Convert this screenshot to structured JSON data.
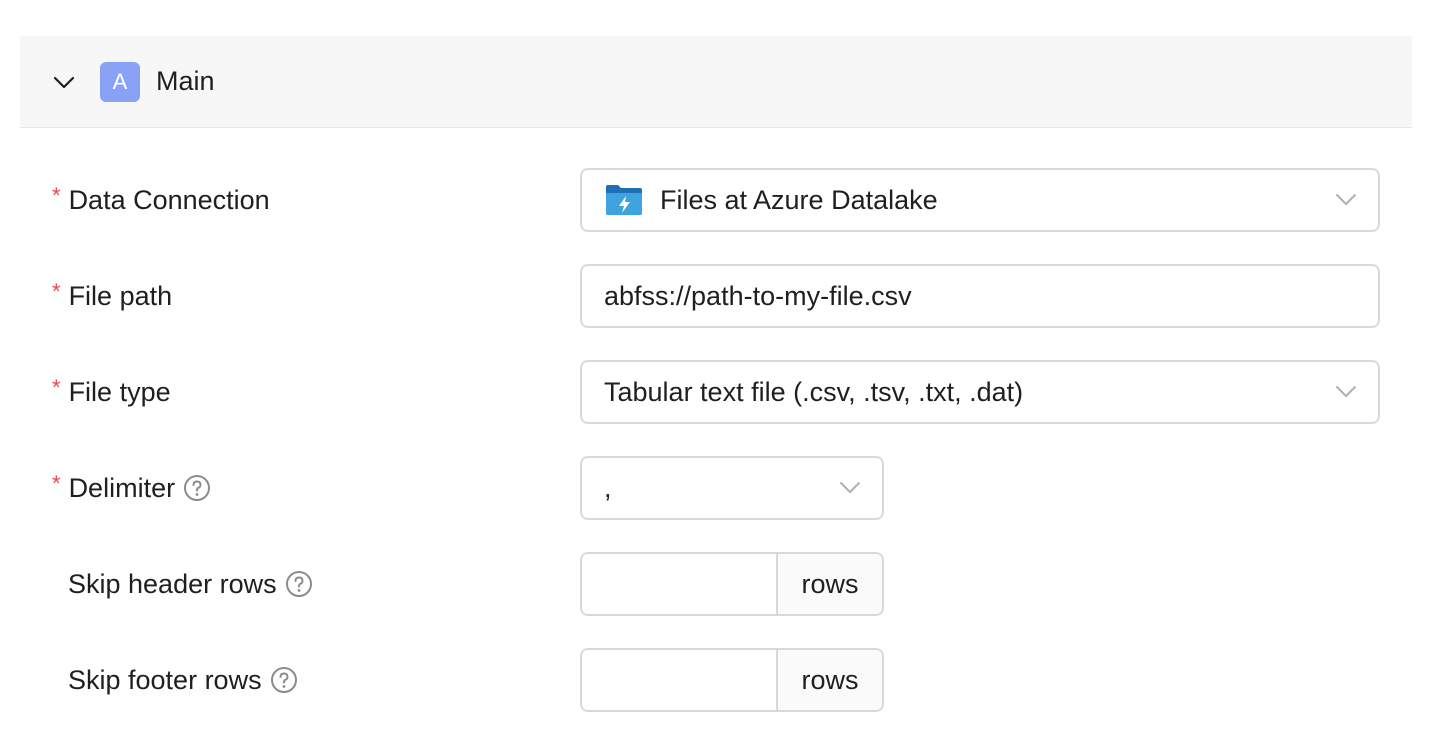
{
  "section": {
    "badge": "A",
    "title": "Main"
  },
  "fields": {
    "data_connection": {
      "label": "Data Connection",
      "required_mark": "*",
      "value": "Files at Azure Datalake"
    },
    "file_path": {
      "label": "File path",
      "required_mark": "*",
      "value": "abfss://path-to-my-file.csv"
    },
    "file_type": {
      "label": "File type",
      "required_mark": "*",
      "value": "Tabular text file (.csv, .tsv, .txt, .dat)"
    },
    "delimiter": {
      "label": "Delimiter",
      "required_mark": "*",
      "value": ","
    },
    "skip_header_rows": {
      "label": "Skip header rows",
      "value": "",
      "addon": "rows"
    },
    "skip_footer_rows": {
      "label": "Skip footer rows",
      "value": "",
      "addon": "rows"
    }
  },
  "colors": {
    "badge": "#8aa2f5",
    "required": "#e5484d",
    "border": "#d9d9d9",
    "header_bg": "#f7f7f8",
    "azure_folder": "#1e6fb8"
  },
  "icons": {
    "collapse": "chevron-down-icon",
    "help": "question-circle-icon",
    "select": "chevron-down-icon",
    "connection": "azure-datalake-folder-icon"
  }
}
